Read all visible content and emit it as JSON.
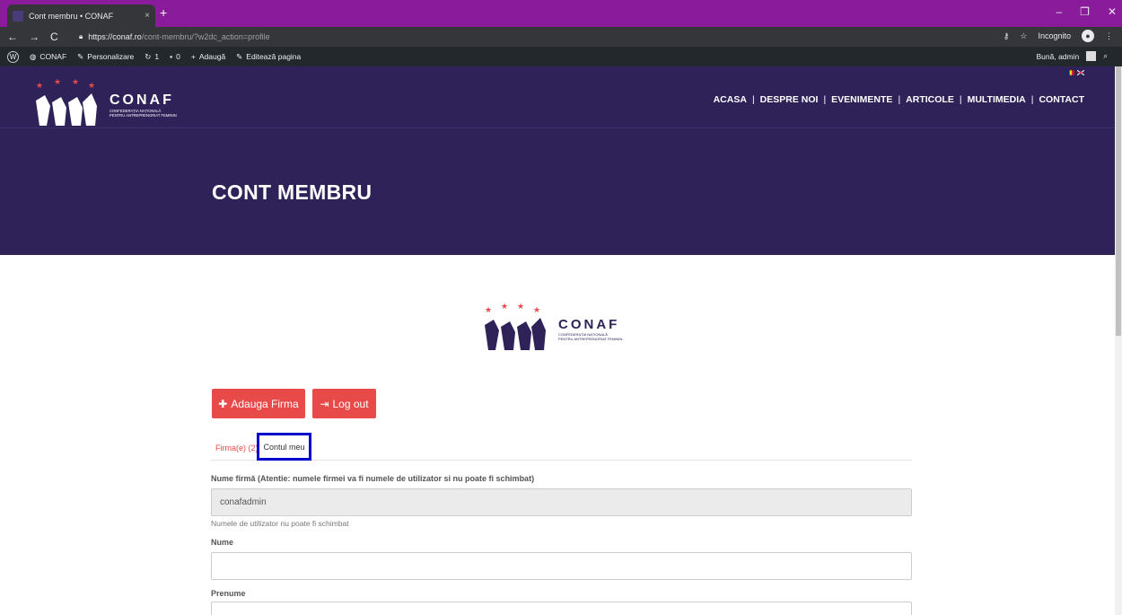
{
  "browser": {
    "tab_title": "Cont membru • CONAF",
    "tab_close": "×",
    "new_tab": "+",
    "url_host": "https://conaf.ro",
    "url_path": "/cont-membru/?w2dc_action=profile",
    "incognito_label": "Incognito",
    "window_controls": [
      "–",
      "❐",
      "✕"
    ]
  },
  "adminbar": {
    "site": "CONAF",
    "customize": "Personalizare",
    "updates": "1",
    "comments": "0",
    "new": "Adaugă",
    "edit": "Editează pagina",
    "greeting": "Bună, admin"
  },
  "header": {
    "logo_name": "CONAF",
    "logo_line1": "CONFEDERAȚIA NAȚIONALĂ",
    "logo_line2": "PENTRU ANTREPRENORIAT FEMININ",
    "menu": [
      "ACASA",
      "DESPRE NOI",
      "EVENIMENTE",
      "ARTICOLE",
      "MULTIMEDIA",
      "CONTACT"
    ],
    "flag_colors": {
      "ro": [
        "#002b7f",
        "#fcd116",
        "#ce1126"
      ],
      "uk": "#012169"
    }
  },
  "hero": {
    "title": "CONT MEMBRU"
  },
  "actions": {
    "add_company": "Adauga Firma",
    "logout": "Log out"
  },
  "tabs": {
    "companies": "Firma(e) (2)",
    "account": "Contul meu"
  },
  "form": {
    "company_label": "Nume firmă (Atentie: numele firmei va fi numele de utilizator si nu poate fi schimbat)",
    "company_value": "conafadmin",
    "company_help": "Numele de utilizator nu poate fi schimbat",
    "last_name_label": "Nume",
    "first_name_label": "Prenume"
  },
  "colors": {
    "brand_purple": "#2e2259",
    "accent_red": "#e84a4a",
    "chrome_purple": "#8a1c9c",
    "highlight_blue": "#0000cc"
  }
}
